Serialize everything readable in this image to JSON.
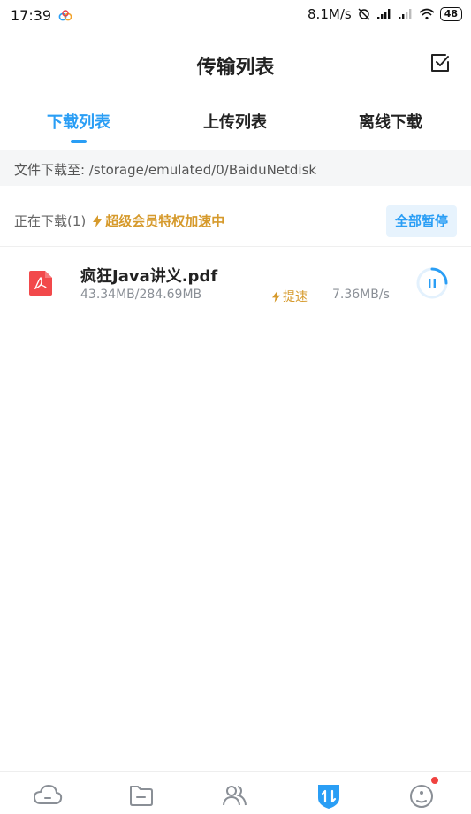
{
  "status_bar": {
    "time": "17:39",
    "net_speed": "8.1M/s",
    "battery": "48"
  },
  "header": {
    "title": "传输列表",
    "edit_icon": "check-square-icon"
  },
  "tabs": [
    {
      "label": "下载列表",
      "active": true
    },
    {
      "label": "上传列表",
      "active": false
    },
    {
      "label": "离线下载",
      "active": false
    }
  ],
  "path": {
    "text": "文件下载至: /storage/emulated/0/BaiduNetdisk"
  },
  "section": {
    "downloading_label": "正在下载(1)",
    "vip_label": "超级会员特权加速中",
    "pause_all_label": "全部暂停"
  },
  "downloads": [
    {
      "file_name": "疯狂Java讲义.pdf",
      "size_progress": "43.34MB/284.69MB",
      "boost_label": "提速",
      "speed": "7.36MB/s",
      "file_icon": "pdf-icon"
    }
  ],
  "bottom_nav": [
    {
      "icon": "cloud-icon"
    },
    {
      "icon": "folder-icon"
    },
    {
      "icon": "contacts-icon"
    },
    {
      "icon": "transfer-icon",
      "active": true
    },
    {
      "icon": "profile-icon",
      "badge": true
    }
  ],
  "colors": {
    "accent": "#2a9ef5",
    "gold": "#d69a2c",
    "pdf_red": "#f2494b"
  }
}
